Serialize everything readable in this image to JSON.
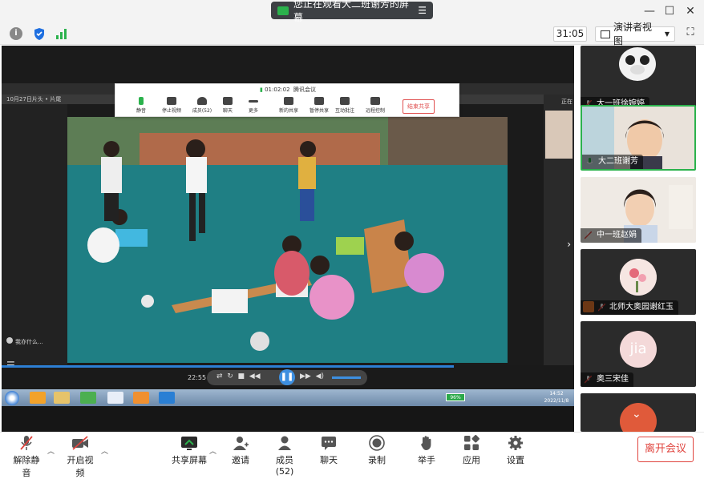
{
  "window": {
    "banner": "您正在观看大二班谢芳的屏幕",
    "minimize": "—",
    "maximize": "☐",
    "close": "✕"
  },
  "toolbar2": {
    "timer": "31:05",
    "presenter_view": "演讲者视图",
    "fullscreen": "⛶"
  },
  "remote": {
    "meeting_time": "01:02:02",
    "app_name": "腾讯会议",
    "header_text": "10月27日片头 • 片尾",
    "left_caption": "我亦什么...",
    "mini_items": [
      "静音",
      "停止视频",
      "成员(52)",
      "聊天",
      "更多",
      "新的共享",
      "暂停共享",
      "互动批注",
      "远程控制"
    ],
    "end_share": "结束共享",
    "player_time": "22:55",
    "battery": "96%",
    "clock_time": "14:52",
    "clock_date": "2022/11/8",
    "corner_text": "正在"
  },
  "participants": [
    {
      "name": "大一班徐婉婷",
      "muted": true
    },
    {
      "name": "大二班谢芳",
      "muted": false
    },
    {
      "name": "中一班赵娟",
      "muted": true
    },
    {
      "name": "北师大奥园谢红玉",
      "muted": true
    },
    {
      "name": "奥三宋佳",
      "avatar_text": "jia",
      "muted": true
    },
    {
      "name": "",
      "muted": true
    }
  ],
  "bottom": {
    "unmute": "解除静音",
    "start_video": "开启视频",
    "share_screen": "共享屏幕",
    "invite": "邀请",
    "members": "成员(52)",
    "chat": "聊天",
    "record": "录制",
    "raise_hand": "举手",
    "apps": "应用",
    "settings": "设置",
    "leave": "离开会议"
  },
  "colors": {
    "accent_green": "#2bb24c",
    "leave_red": "#e0443e",
    "progress_blue": "#2d7fd4"
  }
}
